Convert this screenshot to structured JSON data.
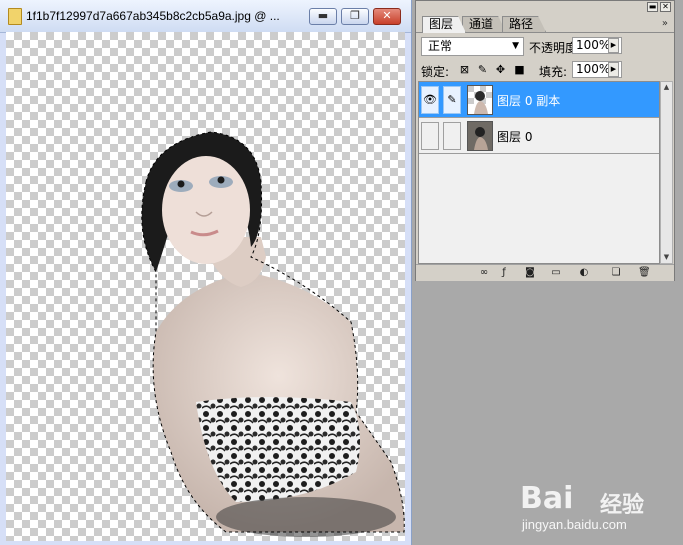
{
  "document": {
    "title": "1f1b7f12997d7a667ab345b8c2cb5a9a.jpg @ ...",
    "buttons": {
      "minimize": "▬",
      "restore": "❐",
      "close": "✕"
    }
  },
  "layers_panel": {
    "tabs": [
      {
        "label": "图层",
        "active": true
      },
      {
        "label": "通道",
        "active": false
      },
      {
        "label": "路径",
        "active": false
      }
    ],
    "blend_mode": "正常",
    "opacity_label": "不透明度:",
    "opacity_value": "100%",
    "lock_label": "锁定:",
    "fill_label": "填充:",
    "fill_value": "100%",
    "layers": [
      {
        "name": "图层 0 副本",
        "selected": true,
        "visible": true
      },
      {
        "name": "图层 0",
        "selected": false,
        "visible": false
      }
    ],
    "icons": {
      "lock_transparency": "checker-icon",
      "lock_paint": "brush-icon",
      "lock_move": "move-icon",
      "lock_all": "lock-icon",
      "footer": [
        "link-icon",
        "fx-icon",
        "mask-icon",
        "folder-icon",
        "adjustment-icon",
        "new-layer-icon",
        "trash-icon"
      ]
    },
    "colors": {
      "selection": "#3399ff"
    }
  },
  "watermark": {
    "brand": "Bai",
    "brand_cn": "经验",
    "url": "jingyan.baidu.com"
  }
}
